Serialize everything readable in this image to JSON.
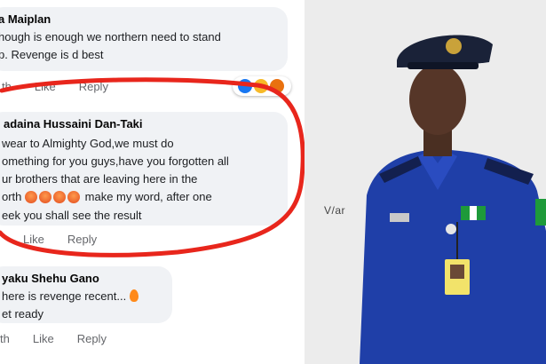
{
  "comments": [
    {
      "author": "a Maiplan",
      "lines": [
        "hough is enough we northern need to stand",
        "p. Revenge is d best"
      ],
      "actions": [
        "th",
        "Like",
        "Reply"
      ]
    },
    {
      "author": "adaina Hussaini Dan-Taki",
      "lines": [
        "wear to Almighty God,we must do",
        "omething for you guys,have you forgotten all",
        "ur brothers that are leaving here in the",
        "orth",
        "eek you shall see the result"
      ],
      "line4_suffix": "make my word, after one",
      "actions": [
        "Like",
        "Reply"
      ]
    },
    {
      "author": "yaku Shehu Gano",
      "lines": [
        "here is revenge recent...",
        "et ready"
      ],
      "actions": [
        "th",
        "Like",
        "Reply"
      ]
    }
  ],
  "reactions": [
    "like-icon",
    "haha-icon",
    "angry-icon"
  ],
  "photo": {
    "wall_mark": "V/ar"
  },
  "colors": {
    "highlight_circle": "#e8261c",
    "uniform": "#1f3fa8",
    "cap": "#1a2238",
    "bubble": "#f0f2f5"
  }
}
